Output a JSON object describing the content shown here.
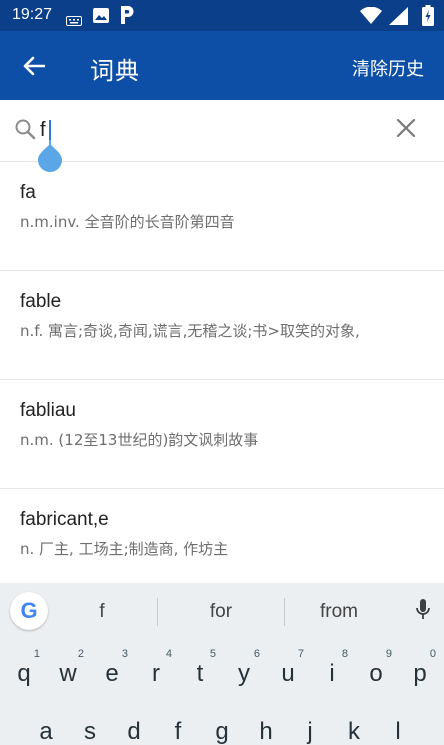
{
  "status_bar": {
    "time": "19:27",
    "icons": [
      "keyboard-icon",
      "image-icon",
      "parking-icon",
      "wifi-icon",
      "signal-icon",
      "battery-icon"
    ]
  },
  "app_bar": {
    "title": "词典",
    "clear_history_label": "清除历史",
    "color": "#0d4ea6"
  },
  "search": {
    "value": "f",
    "placeholder": ""
  },
  "results": [
    {
      "word": "fa",
      "definition": "n.m.inv. 全音阶的长音阶第四音"
    },
    {
      "word": "fable",
      "definition": "n.f. 寓言;奇谈,奇闻,谎言,无稽之谈;书>取笑的对象,"
    },
    {
      "word": "fabliau",
      "definition": "n.m. (12至13世纪的)韵文讽刺故事"
    },
    {
      "word": "fabricant,e",
      "definition": "n. 厂主, 工场主;制造商, 作坊主"
    }
  ],
  "keyboard": {
    "google_label": "G",
    "suggestions": [
      "f",
      "for",
      "from"
    ],
    "row1": [
      {
        "label": "q",
        "hint": "1"
      },
      {
        "label": "w",
        "hint": "2"
      },
      {
        "label": "e",
        "hint": "3"
      },
      {
        "label": "r",
        "hint": "4"
      },
      {
        "label": "t",
        "hint": "5"
      },
      {
        "label": "y",
        "hint": "6"
      },
      {
        "label": "u",
        "hint": "7"
      },
      {
        "label": "i",
        "hint": "8"
      },
      {
        "label": "o",
        "hint": "9"
      },
      {
        "label": "p",
        "hint": "0"
      }
    ],
    "row2": [
      "a",
      "s",
      "d",
      "f",
      "g",
      "h",
      "j",
      "k",
      "l"
    ]
  }
}
